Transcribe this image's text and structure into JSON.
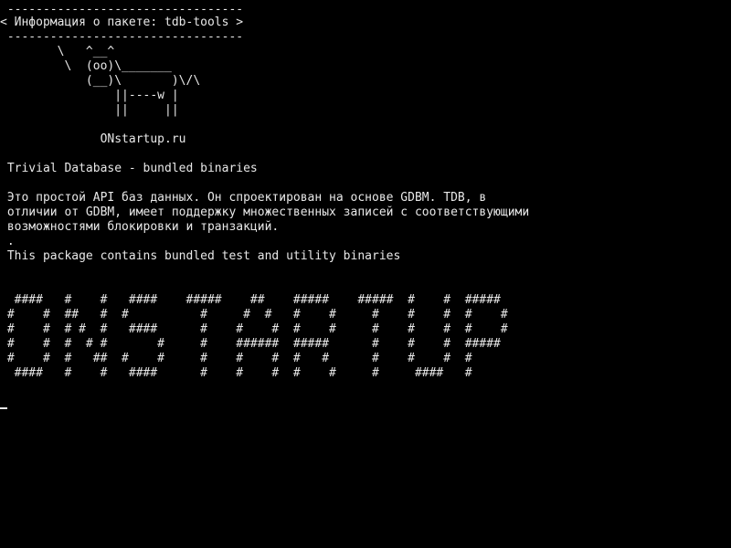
{
  "terminal": {
    "banner": {
      "top_border": " ---------------------------------",
      "title": "< Информация о пакете: tdb-tools >",
      "bottom_border": " ---------------------------------"
    },
    "cow": [
      "        \\   ^__^",
      "         \\  (oo)\\_______",
      "            (__)\\       )\\/\\",
      "                ||----w |",
      "                ||     ||"
    ],
    "site": "              ONstartup.ru",
    "package_title": " Trivial Database - bundled binaries",
    "description": [
      " Это простой API баз данных. Он спроектирован на основе GDBM. TDB, в",
      " отличии от GDBM, имеет поддержку множественных записей с соответствующими",
      " возможностями блокировки и транзакций.",
      " .",
      " This package contains bundled test and utility binaries"
    ],
    "ascii_art": [
      "  ####   #    #   ####    #####    ##    #####    #####  #    #  #####",
      " #    #  ##   #  #          #     #  #   #    #     #    #    #  #    #",
      " #    #  # #  #   ####      #    #    #  #    #     #    #    #  #    #",
      " #    #  #  # #       #     #    ######  #####      #    #    #  #####",
      " #    #  #   ##  #    #     #    #    #  #   #      #    #    #  #",
      "  ####   #    #   ####      #    #    #  #    #     #     ####   #"
    ]
  }
}
